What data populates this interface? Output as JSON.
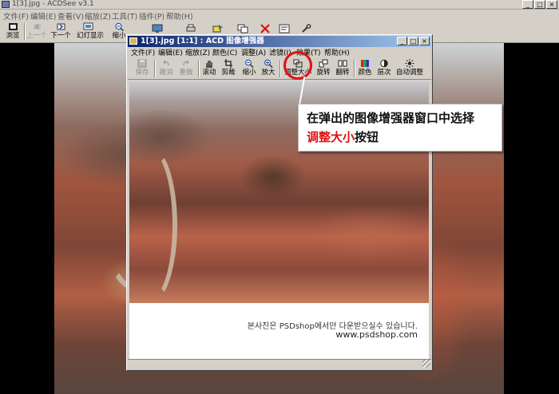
{
  "app": {
    "title": "1[3].jpg - ACDSee v3.1",
    "window_buttons": [
      "_",
      "□",
      "×"
    ]
  },
  "menu": [
    {
      "label": "文件(F)"
    },
    {
      "label": "编辑(E)"
    },
    {
      "label": "查看(V)"
    },
    {
      "label": "缩放(Z)"
    },
    {
      "label": "工具(T)"
    },
    {
      "label": "插件(P)"
    },
    {
      "label": "帮助(H)"
    }
  ],
  "toolbar": [
    {
      "label": "浏览",
      "icon": "browse-icon",
      "dim": false
    },
    {
      "label": "上一个",
      "icon": "previous-icon",
      "dim": true
    },
    {
      "label": "下一个",
      "icon": "next-icon",
      "dim": false
    },
    {
      "label": "幻灯显示",
      "icon": "slideshow-icon",
      "dim": false
    },
    {
      "label": "缩小",
      "icon": "zoom-out-icon",
      "dim": false
    }
  ],
  "enhancer": {
    "title": "1[3].jpg [1:1] : ACD 图像增强器",
    "window_buttons": [
      "_",
      "□",
      "×"
    ],
    "menu": [
      {
        "label": "文件(F)"
      },
      {
        "label": "编辑(E)"
      },
      {
        "label": "缩放(Z)"
      },
      {
        "label": "颜色(C)"
      },
      {
        "label": "调整(A)"
      },
      {
        "label": "滤镜(I)"
      },
      {
        "label": "效果(T)"
      },
      {
        "label": "帮助(H)"
      }
    ],
    "toolbar": [
      {
        "label": "保存",
        "icon": "save-icon",
        "dim": true
      },
      {
        "label": "撤消",
        "icon": "undo-icon",
        "dim": true
      },
      {
        "label": "重做",
        "icon": "redo-icon",
        "dim": true
      },
      {
        "label": "滚动",
        "icon": "hand-icon",
        "dim": false
      },
      {
        "label": "剪裁",
        "icon": "crop-icon",
        "dim": false
      },
      {
        "label": "缩小",
        "icon": "zoom-out-icon",
        "dim": false
      },
      {
        "label": "放大",
        "icon": "zoom-in-icon",
        "dim": false
      },
      {
        "label": "调整大小",
        "icon": "resize-icon",
        "dim": false
      },
      {
        "label": "旋转",
        "icon": "rotate-icon",
        "dim": false
      },
      {
        "label": "翻转",
        "icon": "flip-icon",
        "dim": false
      },
      {
        "label": "颜色",
        "icon": "color-icon",
        "dim": false
      },
      {
        "label": "层次",
        "icon": "levels-icon",
        "dim": false
      },
      {
        "label": "自动调整",
        "icon": "auto-adjust-icon",
        "dim": false
      }
    ],
    "watermark_line1": "본사진은 PSDshop에서만 다운받으실수 있습니다.",
    "watermark_line2": "www.psdshop.com"
  },
  "callout": {
    "line1": "在弹出的图像增强器窗口中选择",
    "highlight": "调整大小",
    "rest": "按钮"
  },
  "colors": {
    "highlight_red": "#e01010",
    "active_title": "#0a246a"
  }
}
